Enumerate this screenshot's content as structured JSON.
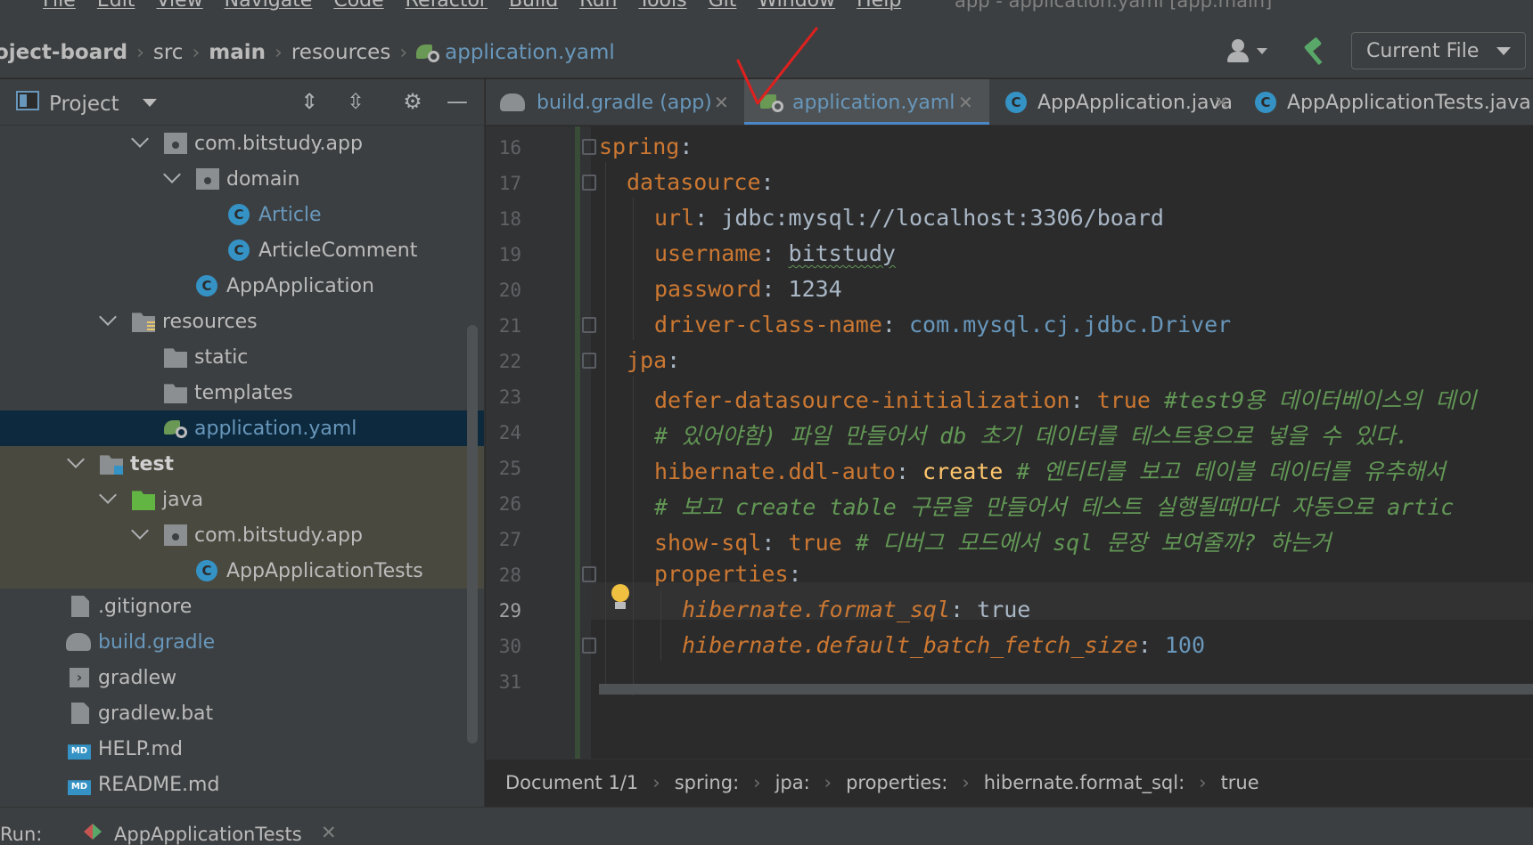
{
  "menu": {
    "items": [
      "File",
      "Edit",
      "View",
      "Navigate",
      "Code",
      "Refactor",
      "Build",
      "Run",
      "Tools",
      "Git",
      "Window",
      "Help"
    ],
    "window_title": "app - application.yaml [app.main]"
  },
  "navbar": {
    "crumbs": [
      "oject-board",
      "src",
      "main",
      "resources",
      "application.yaml"
    ],
    "run_config": "Current File"
  },
  "project_panel": {
    "title": "Project",
    "tree": [
      {
        "label": "com.bitstudy.app",
        "icon": "package-icon"
      },
      {
        "label": "domain",
        "icon": "package-icon"
      },
      {
        "label": "Article",
        "icon": "class-icon"
      },
      {
        "label": "ArticleComment",
        "icon": "class-icon"
      },
      {
        "label": "AppApplication",
        "icon": "spring-class-icon"
      },
      {
        "label": "resources",
        "icon": "resources-folder-icon"
      },
      {
        "label": "static",
        "icon": "folder-icon"
      },
      {
        "label": "templates",
        "icon": "folder-icon"
      },
      {
        "label": "application.yaml",
        "icon": "yaml-icon"
      },
      {
        "label": "test",
        "icon": "test-folder-icon"
      },
      {
        "label": "java",
        "icon": "test-source-folder-icon"
      },
      {
        "label": "com.bitstudy.app",
        "icon": "package-icon"
      },
      {
        "label": "AppApplicationTests",
        "icon": "spring-class-icon"
      },
      {
        "label": ".gitignore",
        "icon": "file-icon"
      },
      {
        "label": "build.gradle",
        "icon": "gradle-icon"
      },
      {
        "label": "gradlew",
        "icon": "terminal-file-icon"
      },
      {
        "label": "gradlew.bat",
        "icon": "file-icon"
      },
      {
        "label": "HELP.md",
        "icon": "markdown-icon"
      },
      {
        "label": "README.md",
        "icon": "markdown-icon"
      }
    ]
  },
  "tabs": [
    {
      "label": "build.gradle (app)",
      "icon": "gradle-icon"
    },
    {
      "label": "application.yaml",
      "icon": "yaml-icon",
      "active": true
    },
    {
      "label": "AppApplication.java",
      "icon": "spring-class-icon"
    },
    {
      "label": "AppApplicationTests.java",
      "icon": "spring-class-icon"
    }
  ],
  "editor": {
    "line_numbers": [
      "16",
      "17",
      "18",
      "19",
      "20",
      "21",
      "22",
      "23",
      "24",
      "25",
      "26",
      "27",
      "28",
      "29",
      "30",
      "31"
    ],
    "current_line": "29",
    "lines": {
      "l16_key": "spring",
      "l17_key": "datasource",
      "l18_key": "url",
      "l18_val": "jdbc:mysql://localhost:3306/board",
      "l19_key": "username",
      "l19_val": "bitstudy",
      "l20_key": "password",
      "l20_val": "1234",
      "l21_key": "driver-class-name",
      "l21_val": "com.mysql.cj.jdbc.Driver",
      "l22_key": "jpa",
      "l23_key": "defer-datasource-initialization",
      "l23_val": "true",
      "l23_comment": "#test9용 데이터베이스의 데이",
      "l24_comment": "# 있어야함) 파일 만들어서 db 초기 데이터를 테스트용으로 넣을 수 있다.",
      "l25_key": "hibernate.ddl-auto",
      "l25_val": "create",
      "l25_comment": "# 엔티티를 보고 테이블 데이터를 유추해서",
      "l26_comment": "# 보고 create table 구문을 만들어서 테스트 실행될때마다 자동으로 artic",
      "l27_key": "show-sql",
      "l27_val": "true",
      "l27_comment": "# 디버그 모드에서 sql 문장 보여줄까? 하는거",
      "l28_key": "properties",
      "l29_key": "hibernate.format_sql",
      "l29_val": "true",
      "l30_key": "hibernate.default_batch_fetch_size",
      "l30_val": "100"
    }
  },
  "editor_breadcrumbs": [
    "Document 1/1",
    "spring:",
    "jpa:",
    "properties:",
    "hibernate.format_sql:",
    "true"
  ],
  "runbar": {
    "label": "Run:",
    "config": "AppApplicationTests"
  },
  "colors": {
    "accent": "#4a88c7",
    "annotation": "#e0201e"
  }
}
